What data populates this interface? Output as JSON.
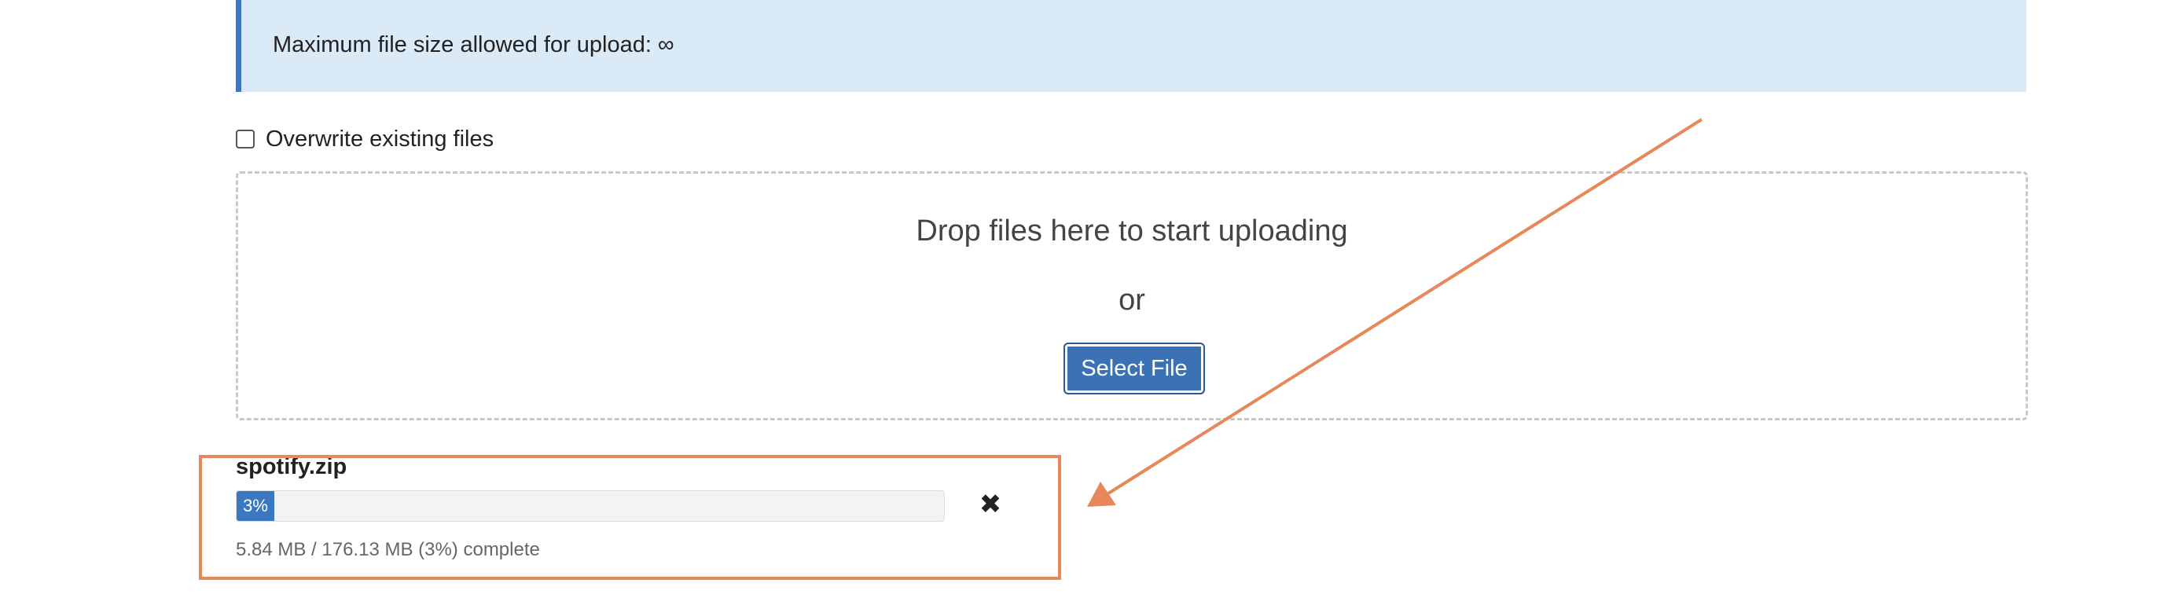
{
  "alert": {
    "message": "Maximum file size allowed for upload: ∞"
  },
  "overwrite": {
    "label": "Overwrite existing files",
    "checked": false
  },
  "dropzone": {
    "drop_text": "Drop files here to start uploading",
    "or_text": "or",
    "select_button_label": "Select File"
  },
  "upload": {
    "filename": "spotify.zip",
    "progress_label": "3%",
    "progress_percent": 3,
    "status": "5.84 MB / 176.13 MB (3%) complete",
    "cancel_icon": "close-icon"
  },
  "colors": {
    "alert_bg": "#dbeaf7",
    "alert_border": "#3f79b5",
    "button_bg": "#3a72b5",
    "progress_fill": "#3a78c2",
    "annotation": "#e8875a"
  }
}
